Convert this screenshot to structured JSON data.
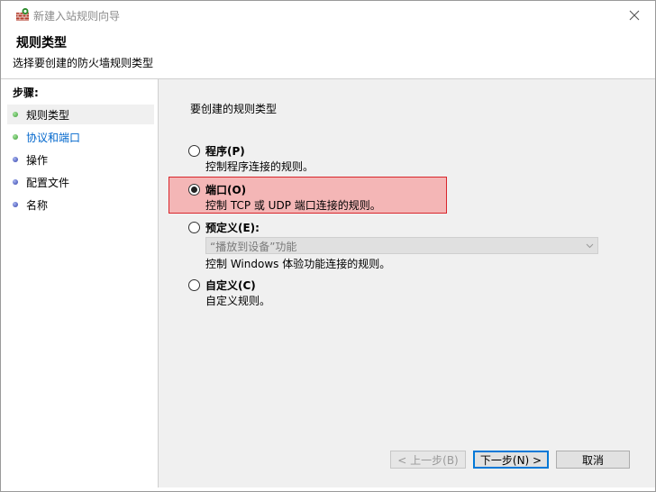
{
  "window": {
    "title": "新建入站规则向导"
  },
  "header": {
    "title": "规则类型",
    "subtitle": "选择要创建的防火墙规则类型"
  },
  "steps": {
    "heading": "步骤:",
    "items": [
      {
        "label": "规则类型"
      },
      {
        "label": "协议和端口"
      },
      {
        "label": "操作"
      },
      {
        "label": "配置文件"
      },
      {
        "label": "名称"
      }
    ]
  },
  "content": {
    "question": "要创建的规则类型",
    "options": [
      {
        "title": "程序(P)",
        "desc": "控制程序连接的规则。",
        "selected": false
      },
      {
        "title": "端口(O)",
        "desc": "控制 TCP 或 UDP 端口连接的规则。",
        "selected": true
      },
      {
        "title": "预定义(E):",
        "desc": "控制 Windows 体验功能连接的规则。",
        "selected": false,
        "dropdown_value": "“播放到设备”功能"
      },
      {
        "title": "自定义(C)",
        "desc": "自定义规则。",
        "selected": false
      }
    ]
  },
  "buttons": {
    "back": "< 上一步(B)",
    "next": "下一步(N) >",
    "cancel": "取消"
  },
  "colors": {
    "highlight": "#f4b6b6",
    "highlight_border": "#d9262c",
    "link": "#0066cc",
    "accent": "#0078d7"
  }
}
